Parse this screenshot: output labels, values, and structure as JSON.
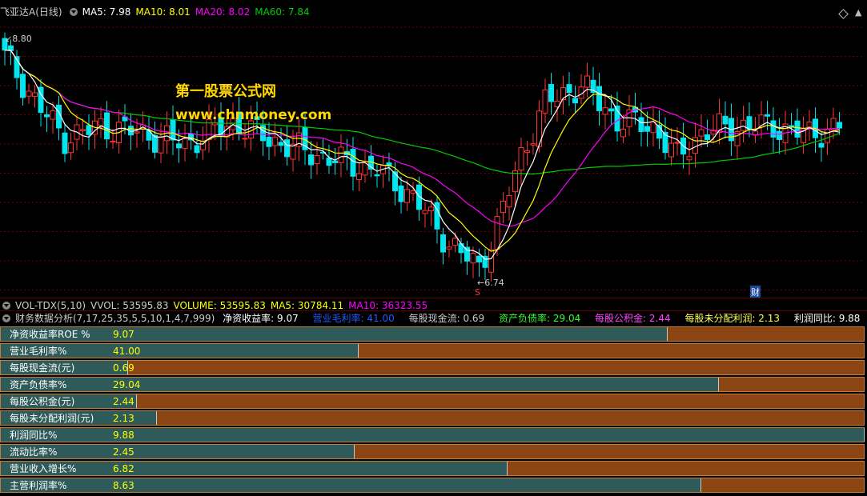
{
  "price_header": {
    "stock": "飞亚达A",
    "period": "(日线)",
    "ma5": "MA5: 7.98",
    "ma10": "MA10: 8.01",
    "ma20": "MA20: 8.02",
    "ma60": "MA60: 7.84"
  },
  "annotations": {
    "high": "8.80",
    "low": "←6.74",
    "cai_marker": "财",
    "s_marker": "S"
  },
  "watermark": {
    "line1": "第一股票公式网",
    "line2": "www.chnmoney.com"
  },
  "vol_header": {
    "name": "VOL-TDX(5,10)",
    "vvol": "VVOL: 53595.83",
    "volume": "VOLUME: 53595.83",
    "ma5": "MA5: 30784.11",
    "ma10": "MA10: 36323.55"
  },
  "fin_header": {
    "name": "财务数据分析(7,17,25,35,5,5,10,1,4,7,999)",
    "items": [
      {
        "text": "净资收益率: 9.07",
        "color": "#ffffff"
      },
      {
        "text": "营业毛利率: 41.00",
        "color": "#1e5bff"
      },
      {
        "text": "每股现金流: 0.69",
        "color": "#cccccc"
      },
      {
        "text": "资产负债率: 29.04",
        "color": "#33ff33"
      },
      {
        "text": "每股公积金: 2.44",
        "color": "#ff44ff"
      },
      {
        "text": "每股未分配利润: 2.13",
        "color": "#ffff55"
      },
      {
        "text": "利润同比: 9.88",
        "color": "#ffffff"
      }
    ]
  },
  "metrics": [
    {
      "label": "净资收益率ROE %",
      "value": "9.07",
      "fill": 0.772
    },
    {
      "label": "营业毛利率%",
      "value": "41.00",
      "fill": 0.414
    },
    {
      "label": "每股现金流(元)",
      "value": "0.69",
      "fill": 0.147
    },
    {
      "label": "资产负债率%",
      "value": "29.04",
      "fill": 0.831
    },
    {
      "label": "每股公积金(元)",
      "value": "2.44",
      "fill": 0.157
    },
    {
      "label": "每股未分配利润(元)",
      "value": "2.13",
      "fill": 0.18
    },
    {
      "label": "利润同比%",
      "value": "9.88",
      "fill": 1.0
    },
    {
      "label": "流动比率%",
      "value": "2.45",
      "fill": 0.409
    },
    {
      "label": "营业收入增长%",
      "value": "6.82",
      "fill": 0.586
    },
    {
      "label": "主营利润率%",
      "value": "8.63",
      "fill": 0.811
    }
  ],
  "colors": {
    "up": "#ff3333",
    "down": "#00e5ee",
    "ma5": "#ffffff",
    "ma10": "#ffff00",
    "ma20": "#ff00ff",
    "ma60": "#00cc00"
  }
}
